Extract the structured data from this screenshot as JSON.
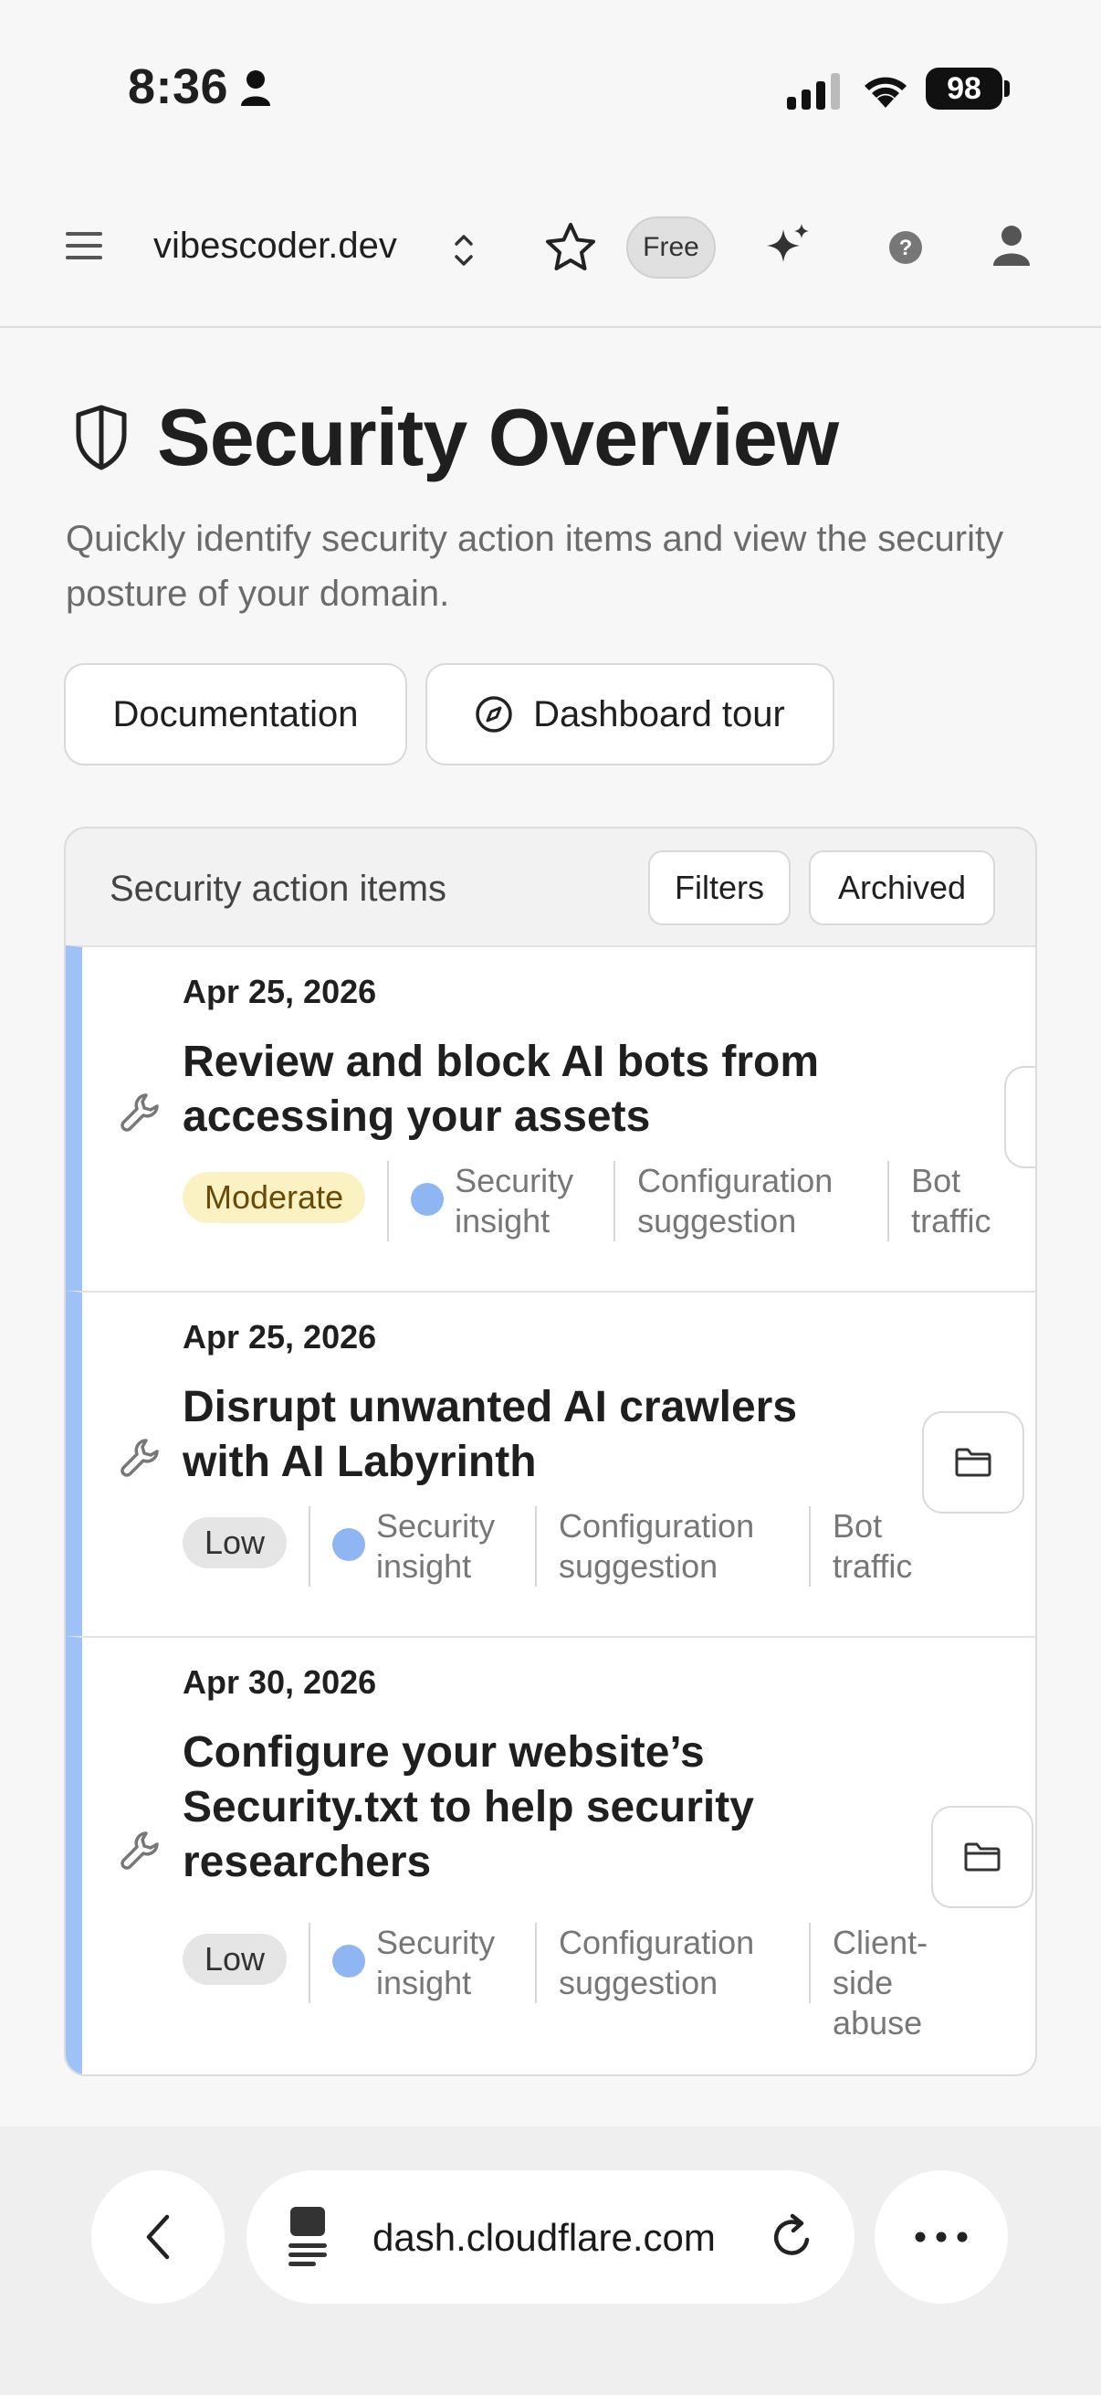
{
  "status_bar": {
    "time": "8:36",
    "battery": "98"
  },
  "top_nav": {
    "domain": "vibescoder.dev",
    "plan_badge": "Free"
  },
  "header": {
    "title": "Security Overview",
    "description": "Quickly identify security action items and view the security posture of your domain.",
    "documentation_label": "Documentation",
    "tour_label": "Dashboard tour"
  },
  "action_items": {
    "title": "Security action items",
    "filters_label": "Filters",
    "archived_label": "Archived",
    "items": [
      {
        "date": "Apr 25, 2026",
        "title": "Review and block AI bots from accessing your assets",
        "severity": "Moderate",
        "tags": [
          "Security insight",
          "Configuration suggestion",
          "Bot traffic"
        ]
      },
      {
        "date": "Apr 25, 2026",
        "title": "Disrupt unwanted AI crawlers with AI Labyrinth",
        "severity": "Low",
        "tags": [
          "Security insight",
          "Configuration suggestion",
          "Bot traffic"
        ]
      },
      {
        "date": "Apr 30, 2026",
        "title": "Configure your website’s Security.txt to help security researchers",
        "severity": "Low",
        "tags": [
          "Security insight",
          "Configuration suggestion",
          "Client-side abuse"
        ]
      }
    ]
  },
  "browser": {
    "url": "dash.cloudflare.com"
  },
  "colors": {
    "item_accent": "#9ec1f7",
    "moderate_bg": "#fbf2c4",
    "low_bg": "#e5e5e5",
    "dot": "#8fb6f3"
  }
}
